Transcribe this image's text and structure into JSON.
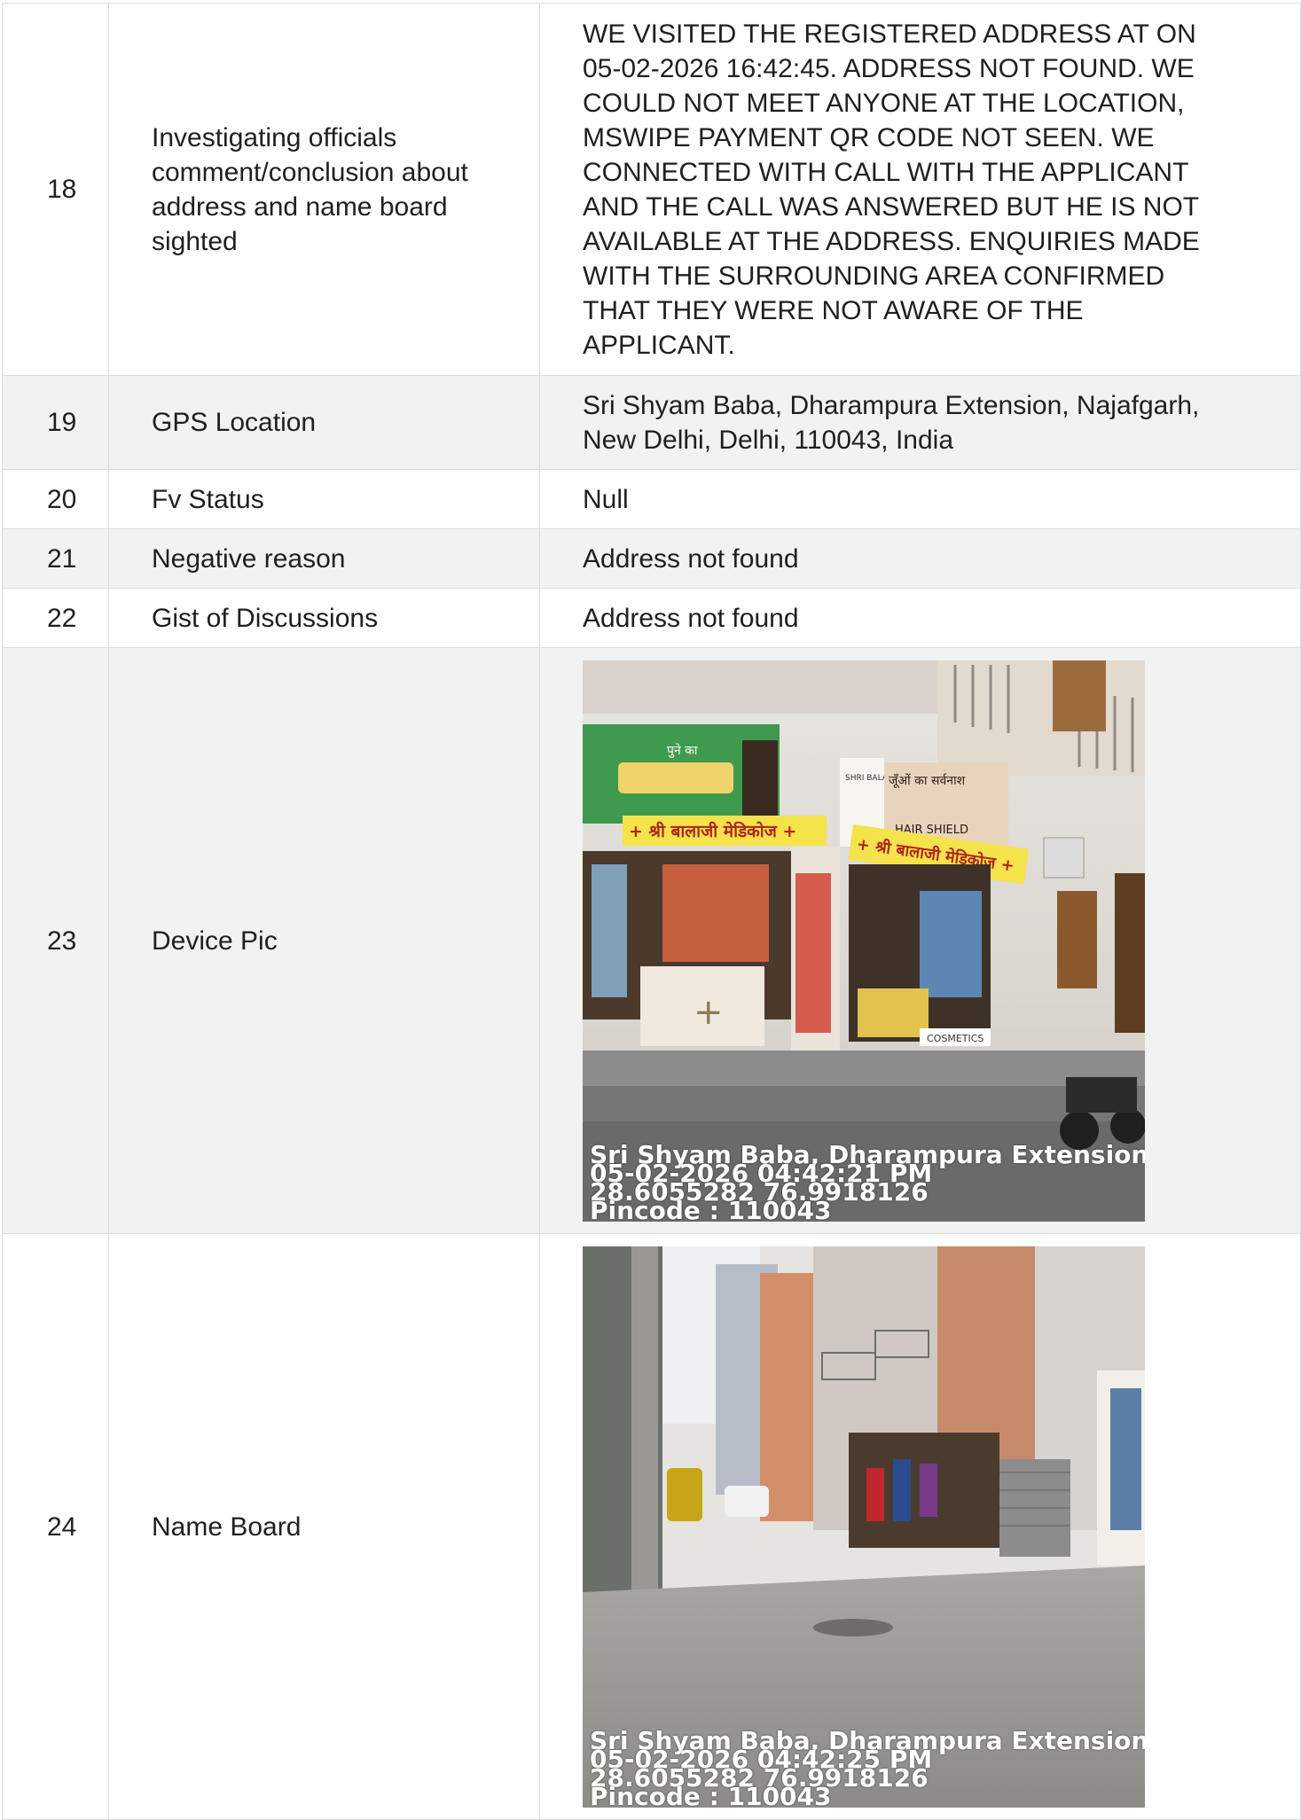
{
  "rows": [
    {
      "no": "18",
      "label_lines": [
        "Investigating officials",
        "comment/conclusion about",
        "address and name board",
        "sighted"
      ],
      "value_lines": [
        "WE VISITED THE REGISTERED ADDRESS AT ON",
        "05-02-2026 16:42:45. ADDRESS NOT FOUND. WE",
        "COULD NOT MEET ANYONE AT THE LOCATION,",
        "MSWIPE PAYMENT QR CODE NOT SEEN. WE",
        "CONNECTED WITH CALL WITH THE APPLICANT",
        "AND THE CALL WAS ANSWERED BUT HE IS NOT",
        "AVAILABLE AT THE ADDRESS. ENQUIRIES MADE",
        "WITH THE SURROUNDING AREA CONFIRMED",
        "THAT THEY WERE NOT AWARE OF THE",
        "APPLICANT."
      ]
    },
    {
      "no": "19",
      "label": "GPS Location",
      "value_lines": [
        "Sri Shyam Baba, Dharampura Extension, Najafgarh,",
        "New Delhi, Delhi, 110043, India"
      ]
    },
    {
      "no": "20",
      "label": "Fv Status",
      "value": "Null"
    },
    {
      "no": "21",
      "label": "Negative reason",
      "value": "Address not found"
    },
    {
      "no": "22",
      "label": "Gist of Discussions",
      "value": "Address not found"
    },
    {
      "no": "23",
      "label": "Device Pic",
      "photo": {
        "overlay_lines": [
          "Sri Shyam Baba, Dharampura Extension, Naja",
          "05-02-2026 04:42:21 PM",
          "28.6055282 76.9918126",
          "Pincode : 110043"
        ],
        "signs": [
          "+ श्री बालाजी मेडिकोज +",
          "+ श्री बालाजी मेडिकोज +",
          "जूँओं का सर्वनाश",
          "HAIR SHIELD",
          "SHRI BALAJI MEDICOS",
          "COSMETICS",
          "पुने का"
        ]
      }
    },
    {
      "no": "24",
      "label": "Name Board",
      "photo": {
        "overlay_lines": [
          "Sri Shyam Baba, Dharampura Extension, Naja",
          "05-02-2026 04:42:25 PM",
          "28.6055282 76.9918126",
          "Pincode : 110043"
        ]
      }
    }
  ],
  "colors": {
    "shade": "#f2f2f2",
    "border": "#dcdcdc",
    "text": "#1f1f1f"
  }
}
